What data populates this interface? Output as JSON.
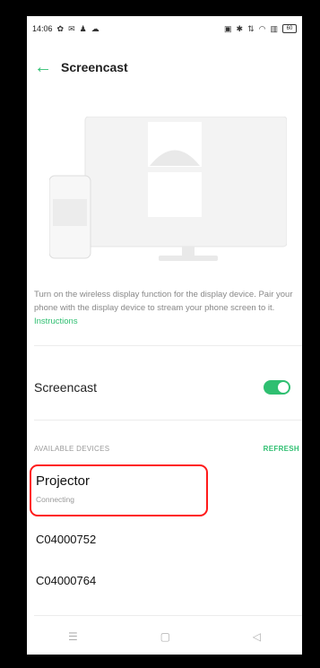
{
  "status_bar": {
    "time": "14:06",
    "battery": "60"
  },
  "header": {
    "title": "Screencast"
  },
  "description": {
    "text": "Turn on the wireless display function for the display device. Pair your phone with the display device to stream your phone screen to it. ",
    "link": "Instructions"
  },
  "screencast_toggle": {
    "label": "Screencast",
    "state": "on"
  },
  "available_devices": {
    "title": "AVAILABLE DEVICES",
    "refresh_label": "REFRESH",
    "items": [
      {
        "name": "Projector",
        "status": "Connecting"
      },
      {
        "name": "C04000752"
      },
      {
        "name": "C04000764"
      }
    ]
  },
  "colors": {
    "accent": "#2fbf71",
    "highlight": "#ff1a1a",
    "bezel": "#000000"
  }
}
